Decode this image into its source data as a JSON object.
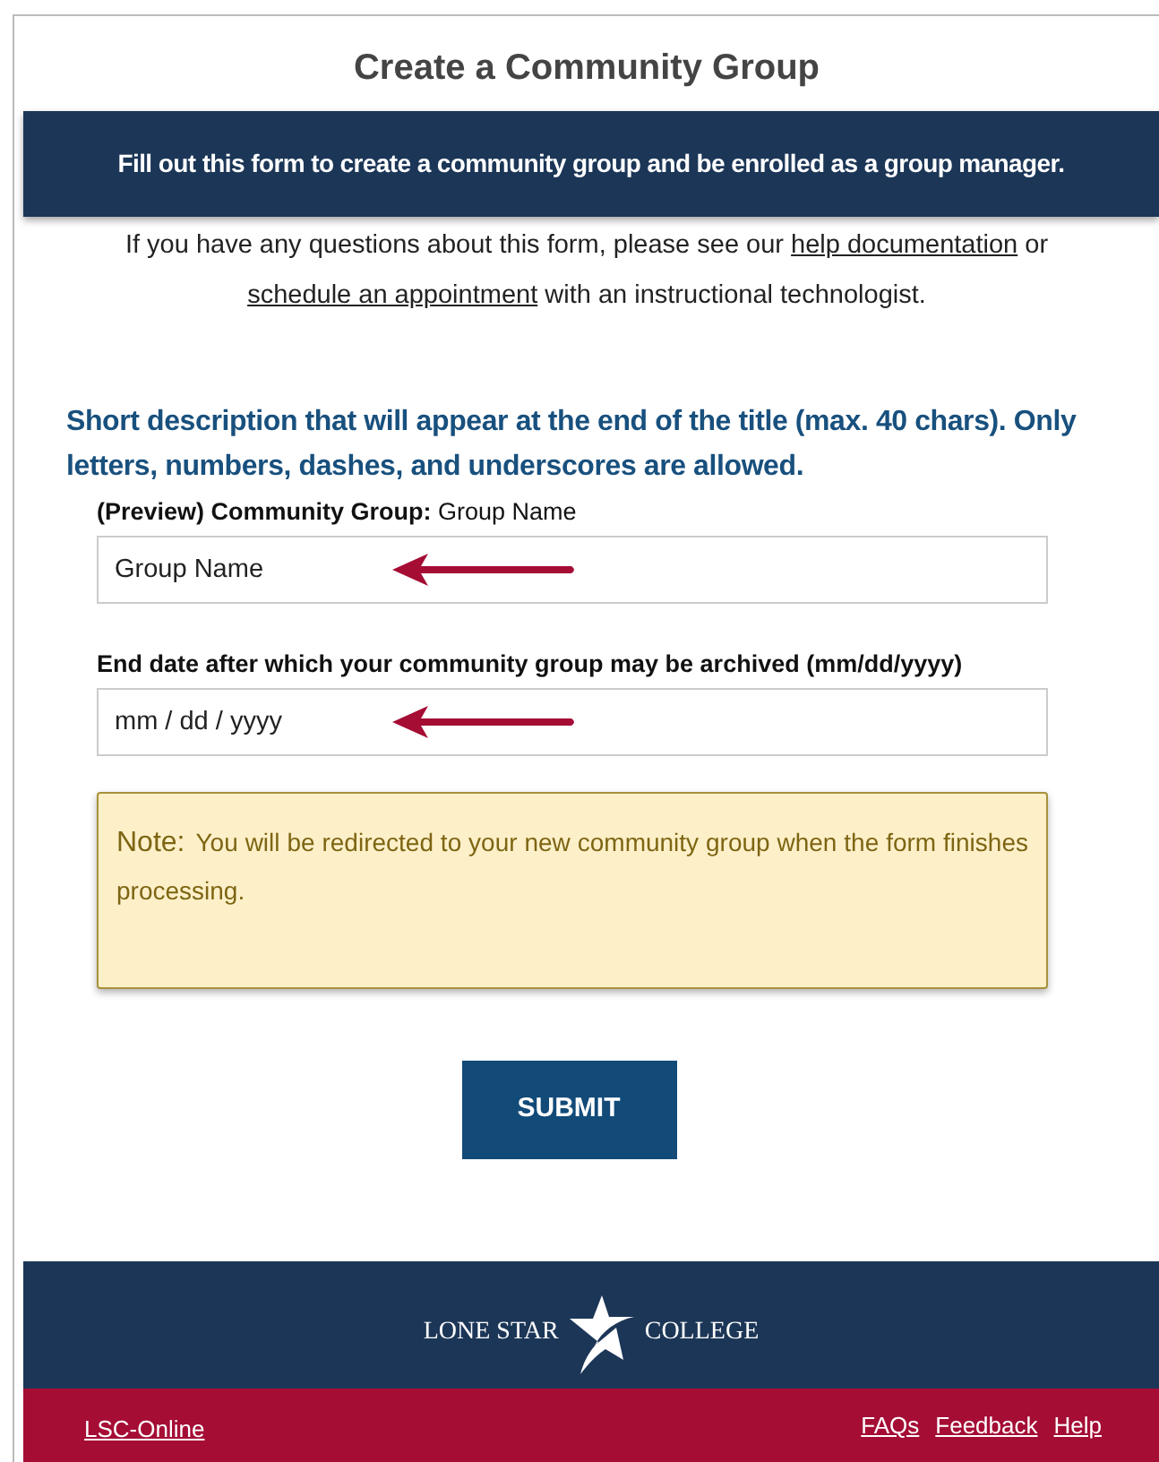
{
  "title": "Create a Community Group",
  "banner": "Fill out this form to create a community group and be enrolled as a group manager.",
  "intro": [
    {
      "kind": "text",
      "text": "If you have any questions about this form, please see our "
    },
    {
      "kind": "link",
      "text": "help documentation"
    },
    {
      "kind": "text",
      "text": " or "
    },
    {
      "kind": "break"
    },
    {
      "kind": "link",
      "text": "schedule an appointment"
    },
    {
      "kind": "text",
      "text": " with an instructional technologist."
    }
  ],
  "section_heading": "Short description that will appear at the end of the title (max. 40 chars). Only letters, numbers, dashes, and underscores are allowed.",
  "fields": [
    {
      "label": "**(Preview) Community Group:** Group Name",
      "value": "Group Name",
      "arrow": true
    },
    {
      "label": "End date after which your community group may be archived (mm/dd/yyyy)",
      "placeholder": "mm / dd / yyyy",
      "arrow": true
    }
  ],
  "note": {
    "label": "Note:",
    "text": "You will be redirected to your new community group when the form finishes processing."
  },
  "submit": "SUBMIT",
  "footer": {
    "logo_left": "LONE STAR",
    "logo_right": "COLLEGE",
    "left_link": "LSC-Online",
    "right_links": [
      "FAQs",
      "Feedback",
      "Help"
    ]
  }
}
